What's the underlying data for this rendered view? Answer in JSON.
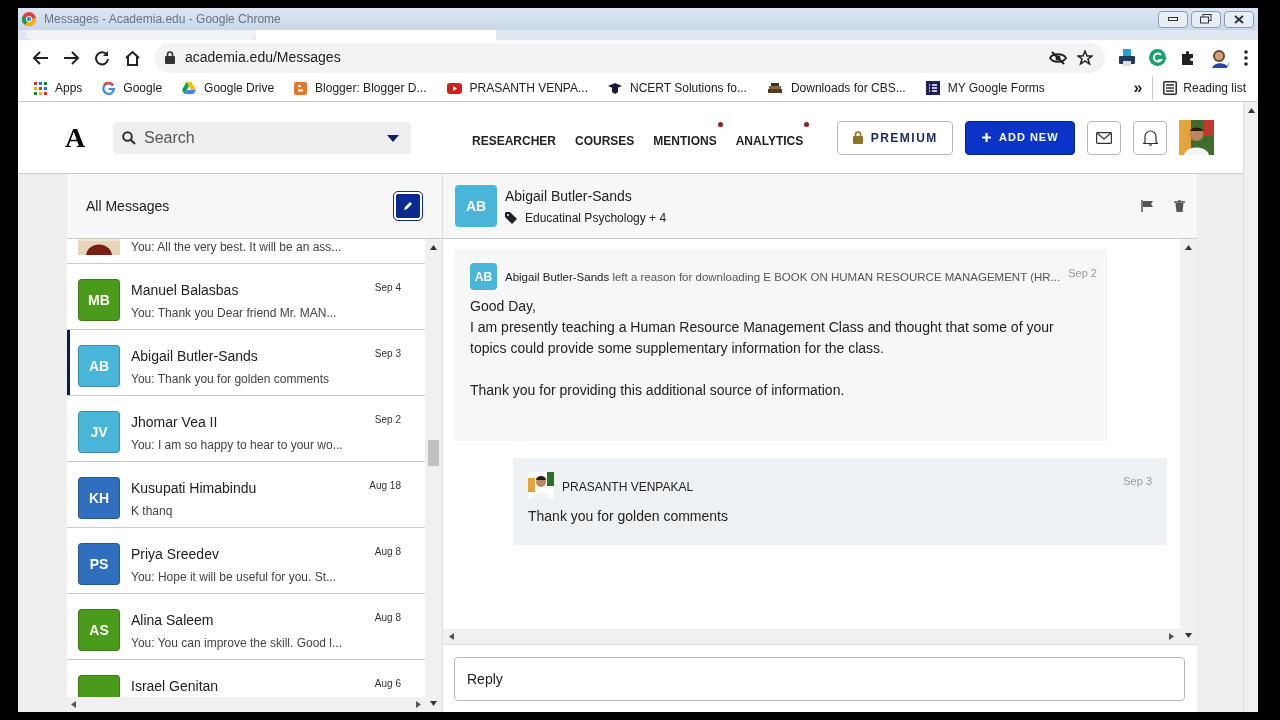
{
  "window": {
    "title": "Messages - Academia.edu - Google Chrome"
  },
  "browser": {
    "url": "academia.edu/Messages",
    "bookmarks": [
      {
        "label": "Apps"
      },
      {
        "label": "Google"
      },
      {
        "label": "Google Drive"
      },
      {
        "label": "Blogger: Blogger D..."
      },
      {
        "label": "PRASANTH VENPA..."
      },
      {
        "label": "NCERT Solutions fo..."
      },
      {
        "label": "Downloads for CBS..."
      },
      {
        "label": "MY Google Forms"
      }
    ],
    "more": "»",
    "reading_list": "Reading list"
  },
  "site": {
    "logo": "A",
    "search": {
      "placeholder": "Search"
    },
    "nav": [
      {
        "label": "RESEARCHER",
        "notification_dot": false
      },
      {
        "label": "COURSES",
        "notification_dot": false
      },
      {
        "label": "MENTIONS",
        "notification_dot": true
      },
      {
        "label": "ANALYTICS",
        "notification_dot": true
      }
    ],
    "premium": "PREMIUM",
    "add_new": "ADD NEW"
  },
  "inbox": {
    "title": "All Messages",
    "conversations": [
      {
        "kind": "picture",
        "preview": "You: All the very best. It will be an ass...",
        "selected": false
      },
      {
        "kind": "initials",
        "initials": "MB",
        "color": "#4a9a1c",
        "name": "Manuel Balasbas",
        "preview": "You: Thank you Dear friend Mr. MAN...",
        "date": "Sep 4",
        "selected": false
      },
      {
        "kind": "initials",
        "initials": "AB",
        "color": "#49b5d8",
        "name": "Abigail Butler-Sands",
        "preview": "You: Thank you for golden comments",
        "date": "Sep 3",
        "selected": true
      },
      {
        "kind": "initials",
        "initials": "JV",
        "color": "#49b5d8",
        "name": "Jhomar Vea II",
        "preview": "You: I am so happy to hear to your wo...",
        "date": "Sep 2",
        "selected": false
      },
      {
        "kind": "initials",
        "initials": "KH",
        "color": "#2f6fbd",
        "name": "Kusupati Himabindu",
        "preview": "K thanq",
        "date": "Aug 18",
        "selected": false
      },
      {
        "kind": "initials",
        "initials": "PS",
        "color": "#2f6fbd",
        "name": "Priya Sreedev",
        "preview": "You: Hope it will be useful for you. St...",
        "date": "Aug 8",
        "selected": false
      },
      {
        "kind": "initials",
        "initials": "AS",
        "color": "#4a9a1c",
        "name": "Alina Saleem",
        "preview": "You: You can improve the skill. Good l...",
        "date": "Aug 8",
        "selected": false
      },
      {
        "kind": "initials",
        "color": "#4a9a1c",
        "name": "Israel Genitan",
        "date": "Aug 6",
        "selected": false
      }
    ]
  },
  "thread": {
    "initials": "AB",
    "color": "#49b5d8",
    "name": "Abigail Butler-Sands",
    "tag": "Educatinal Psychology + 4",
    "messages": [
      {
        "kind": "incoming",
        "initials": "AB",
        "color": "#49b5d8",
        "header": "**Abigail Butler-Sands** left a reason for downloading E BOOK ON HUMAN RESOURCE MANAGEMENT (HR...",
        "date": "Sep 2",
        "paragraphs": [
          "Good Day,\nI am presently teaching a Human Resource Management Class and thought that some of your topics could provide some supplementary information for the class.",
          "Thank you for providing this additional source of information."
        ]
      },
      {
        "kind": "outgoing",
        "sender": "PRASANTH VENPAKAL",
        "date": "Sep 3",
        "paragraphs": [
          "Thank you for golden comments"
        ]
      }
    ]
  },
  "reply": {
    "placeholder": "Reply"
  }
}
